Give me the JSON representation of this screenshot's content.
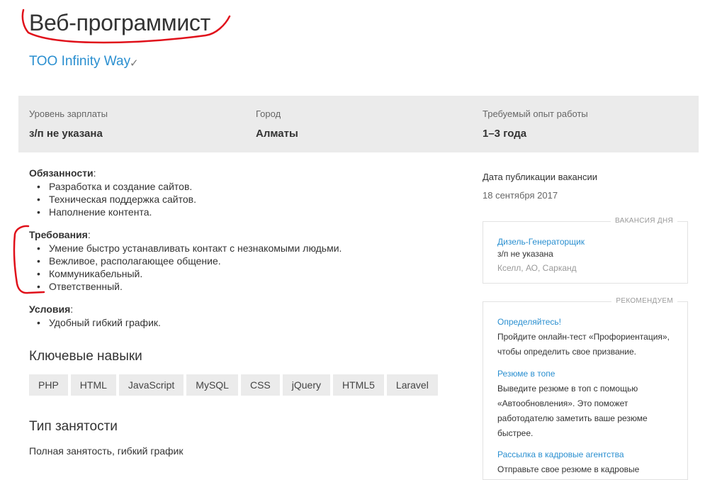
{
  "vacancy": {
    "title": "Веб-программист",
    "company": "ТОО Infinity Way",
    "company_check_icon": "check-icon"
  },
  "info": {
    "salary_label": "Уровень зарплаты",
    "salary_value": "з/п не указана",
    "city_label": "Город",
    "city_value": "Алматы",
    "experience_label": "Требуемый опыт работы",
    "experience_value": "1–3 года"
  },
  "duties": {
    "title": "Обязанности",
    "items": [
      "Разработка и создание сайтов.",
      "Техническая поддержка сайтов.",
      "Наполнение контента."
    ]
  },
  "requirements": {
    "title": "Требования",
    "items": [
      "Умение быстро устанавливать контакт с незнакомыми людьми.",
      "Вежливое, располагающее общение.",
      "Коммуникабельный.",
      "Ответственный."
    ]
  },
  "conditions": {
    "title": "Условия",
    "items": [
      "Удобный гибкий график."
    ]
  },
  "skills": {
    "title": "Ключевые навыки",
    "items": [
      "PHP",
      "HTML",
      "JavaScript",
      "MySQL",
      "CSS",
      "jQuery",
      "HTML5",
      "Laravel"
    ]
  },
  "employment": {
    "title": "Тип занятости",
    "value": "Полная занятость, гибкий график"
  },
  "sidebar": {
    "pub_label": "Дата публикации вакансии",
    "pub_date": "18 сентября 2017",
    "vacancy_of_day": {
      "tag": "ВАКАНСИЯ ДНЯ",
      "title": "Дизель-Генераторщик",
      "salary": "з/п не указана",
      "company": "Кселл, АО, Сарканд"
    },
    "recommend": {
      "tag": "РЕКОМЕНДУЕМ",
      "items": [
        {
          "title": "Определяйтесь!",
          "text": "Пройдите онлайн-тест «Профориентация», чтобы определить свое призвание."
        },
        {
          "title": "Резюме в топе",
          "text": "Выведите резюме в топ с помощью «Автообновления». Это поможет работодателю заметить ваше резюме быстрее."
        },
        {
          "title": "Рассылка в кадровые агентства",
          "text": "Отправьте свое резюме в кадровые"
        }
      ]
    }
  },
  "colors": {
    "link": "#2a8fd0",
    "info_bg": "#ebebeb",
    "annotation": "#e0101a"
  }
}
